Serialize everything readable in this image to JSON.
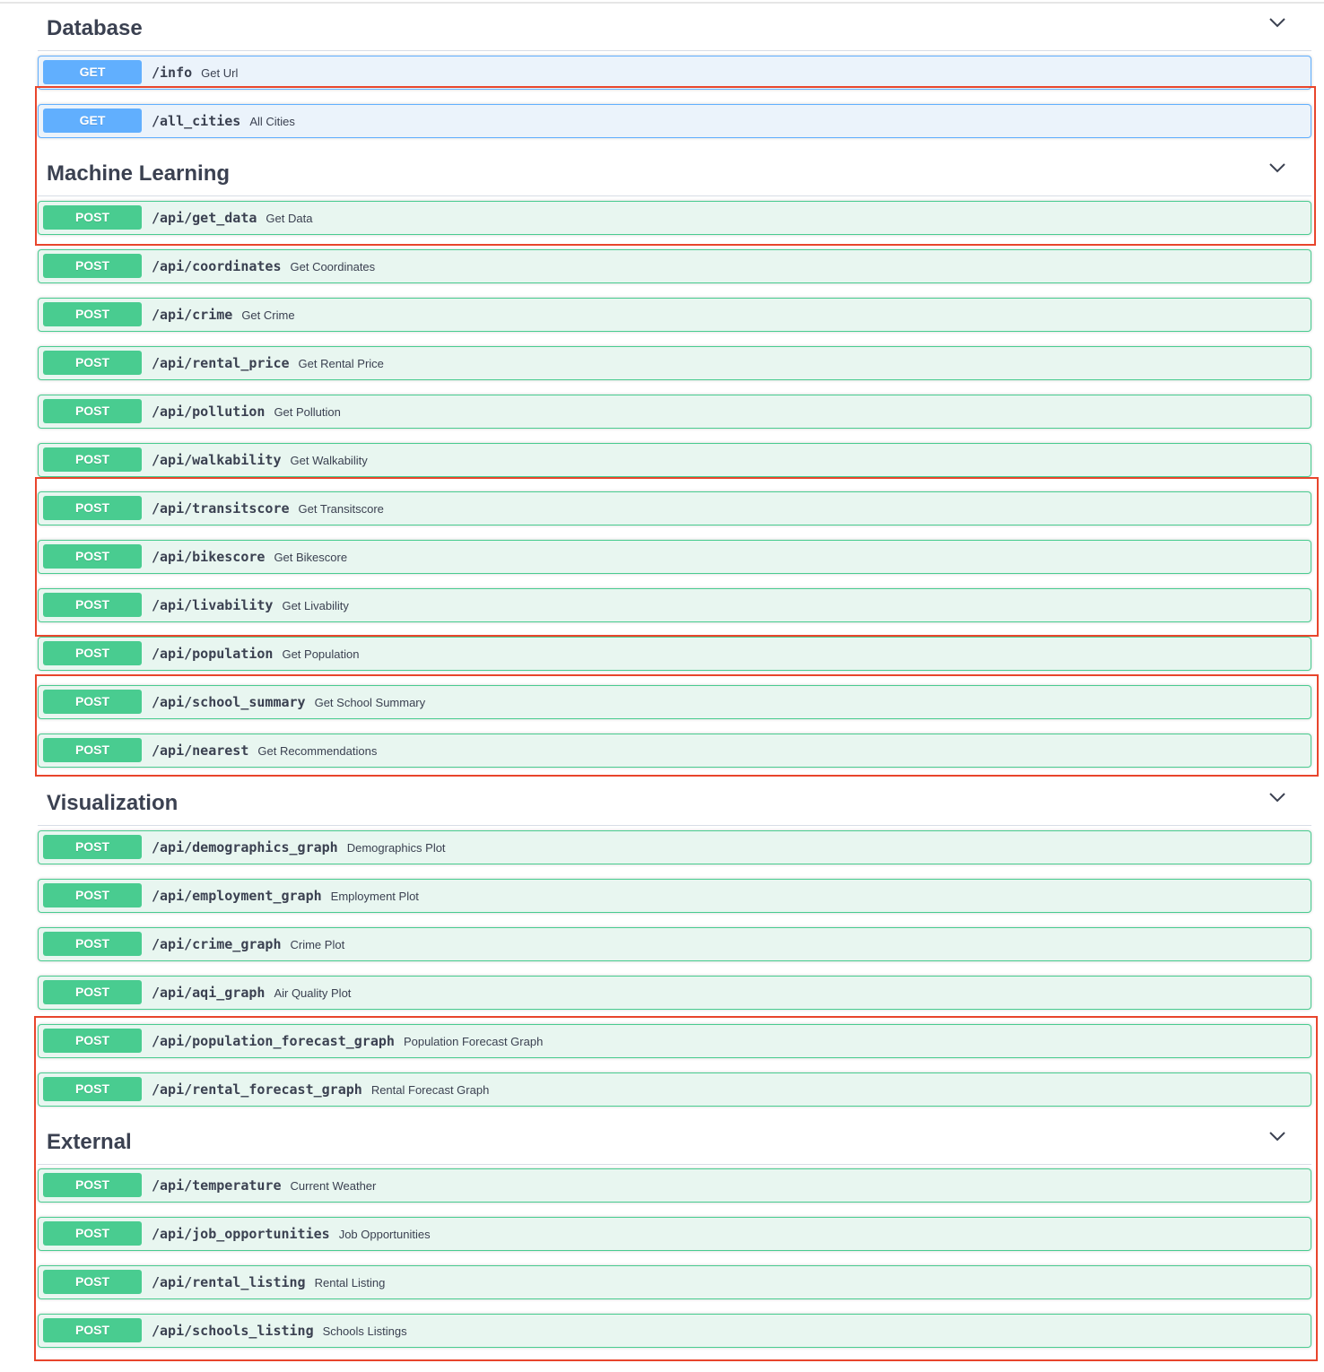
{
  "sections": [
    {
      "id": "database",
      "title": "Database",
      "operations": [
        {
          "method": "GET",
          "path": "/info",
          "summary": "Get Url"
        },
        {
          "method": "GET",
          "path": "/all_cities",
          "summary": "All Cities"
        }
      ]
    },
    {
      "id": "machine-learning",
      "title": "Machine Learning",
      "operations": [
        {
          "method": "POST",
          "path": "/api/get_data",
          "summary": "Get Data"
        },
        {
          "method": "POST",
          "path": "/api/coordinates",
          "summary": "Get Coordinates"
        },
        {
          "method": "POST",
          "path": "/api/crime",
          "summary": "Get Crime"
        },
        {
          "method": "POST",
          "path": "/api/rental_price",
          "summary": "Get Rental Price"
        },
        {
          "method": "POST",
          "path": "/api/pollution",
          "summary": "Get Pollution"
        },
        {
          "method": "POST",
          "path": "/api/walkability",
          "summary": "Get Walkability"
        },
        {
          "method": "POST",
          "path": "/api/transitscore",
          "summary": "Get Transitscore"
        },
        {
          "method": "POST",
          "path": "/api/bikescore",
          "summary": "Get Bikescore"
        },
        {
          "method": "POST",
          "path": "/api/livability",
          "summary": "Get Livability"
        },
        {
          "method": "POST",
          "path": "/api/population",
          "summary": "Get Population"
        },
        {
          "method": "POST",
          "path": "/api/school_summary",
          "summary": "Get School Summary"
        },
        {
          "method": "POST",
          "path": "/api/nearest",
          "summary": "Get Recommendations"
        }
      ]
    },
    {
      "id": "visualization",
      "title": "Visualization",
      "operations": [
        {
          "method": "POST",
          "path": "/api/demographics_graph",
          "summary": "Demographics Plot"
        },
        {
          "method": "POST",
          "path": "/api/employment_graph",
          "summary": "Employment Plot"
        },
        {
          "method": "POST",
          "path": "/api/crime_graph",
          "summary": "Crime Plot"
        },
        {
          "method": "POST",
          "path": "/api/aqi_graph",
          "summary": "Air Quality Plot"
        },
        {
          "method": "POST",
          "path": "/api/population_forecast_graph",
          "summary": "Population Forecast Graph"
        },
        {
          "method": "POST",
          "path": "/api/rental_forecast_graph",
          "summary": "Rental Forecast Graph"
        }
      ]
    },
    {
      "id": "external",
      "title": "External",
      "operations": [
        {
          "method": "POST",
          "path": "/api/temperature",
          "summary": "Current Weather"
        },
        {
          "method": "POST",
          "path": "/api/job_opportunities",
          "summary": "Job Opportunities"
        },
        {
          "method": "POST",
          "path": "/api/rental_listing",
          "summary": "Rental Listing"
        },
        {
          "method": "POST",
          "path": "/api/schools_listing",
          "summary": "Schools Listings"
        }
      ]
    }
  ],
  "colors": {
    "get": "#61affe",
    "post": "#49cc90",
    "highlight": "#e8452c"
  },
  "icons": {
    "section_toggle": "chevron-down-icon"
  }
}
